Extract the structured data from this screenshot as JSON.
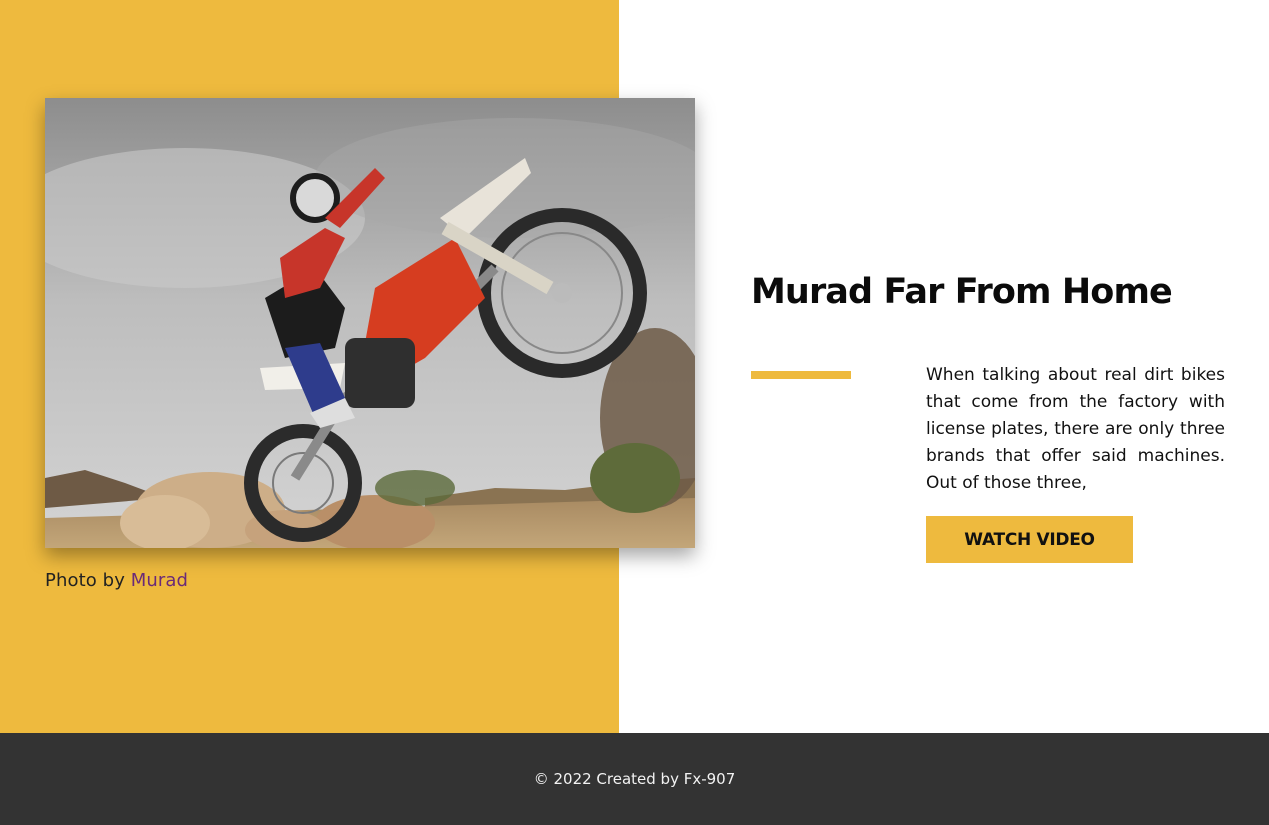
{
  "hero": {
    "image_alt": "Dirt bike rider doing a wheelie over rocks",
    "credit_prefix": "Photo by",
    "credit_author": "Murad"
  },
  "content": {
    "title": "Murad Far From Home",
    "description": "When talking about real dirt bikes that come from the factory with license plates, there are only three brands that offer said machines. Out of those three,",
    "button_label": "WATCH VIDEO"
  },
  "footer": {
    "text": "© 2022 Created by Fx-907"
  },
  "colors": {
    "accent": "#eeba3e",
    "footer_bg": "#333333",
    "link": "#6a2a78"
  }
}
